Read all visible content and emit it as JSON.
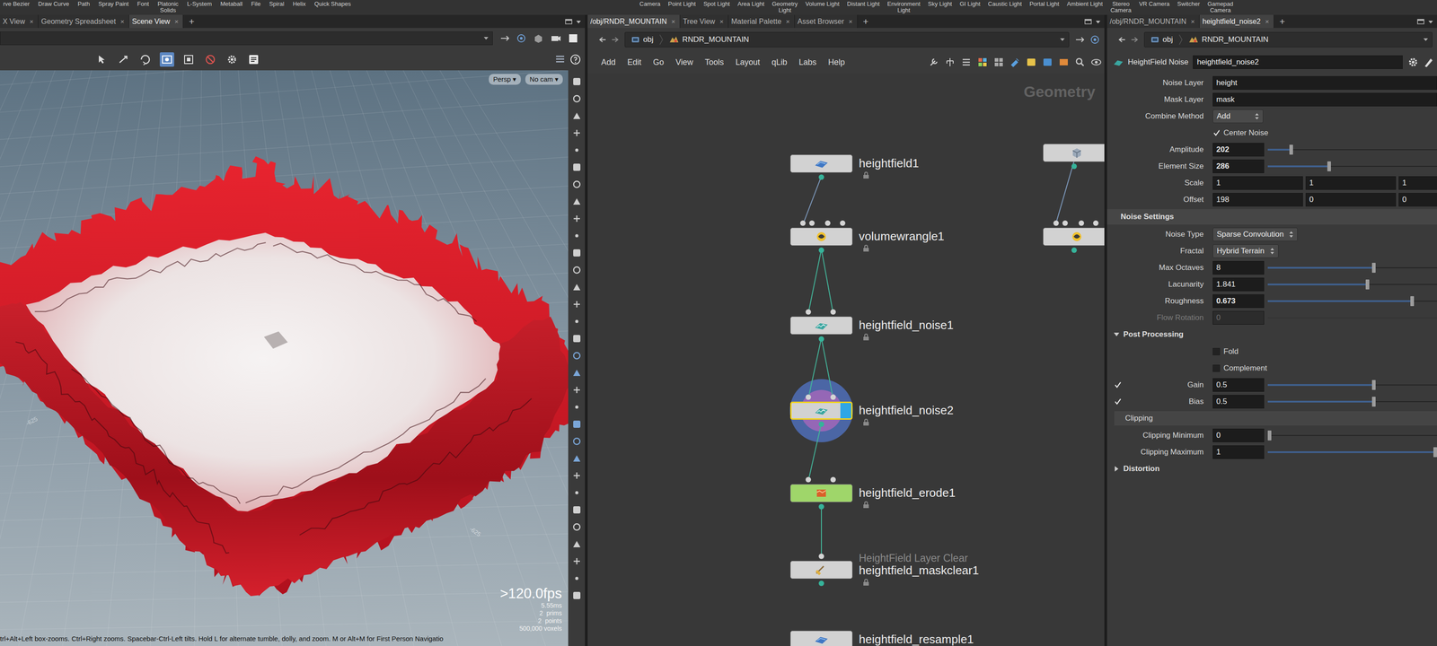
{
  "shelf": {
    "left": [
      "rve Bezier",
      "Draw Curve",
      "Path",
      "Spray Paint",
      "Font",
      "Platonic\nSolids",
      "L-System",
      "Metaball",
      "File",
      "Spiral",
      "Helix",
      "Quick Shapes"
    ],
    "right": [
      "Camera",
      "Point Light",
      "Spot Light",
      "Area Light",
      "Geometry\nLight",
      "Volume Light",
      "Distant Light",
      "Environment\nLight",
      "Sky Light",
      "GI Light",
      "Caustic Light",
      "Portal Light",
      "Ambient Light",
      "Stereo\nCamera",
      "VR Camera",
      "Switcher",
      "Gamepad\nCamera"
    ]
  },
  "tab_close": "×",
  "tab_add": "+",
  "viewer": {
    "tabs": [
      {
        "label": "X View",
        "selected": false
      },
      {
        "label": "Geometry Spreadsheet",
        "selected": false
      },
      {
        "label": "Scene View",
        "selected": true
      }
    ],
    "camera": "Persp",
    "camera_target": "No cam",
    "menu_arrow": "▾",
    "fps": ">120.0fps",
    "frame_time": "5.55ms",
    "stats": [
      "2  prims",
      "2  points",
      "500,000 voxels"
    ],
    "grid_labels": [
      "-625",
      "-625"
    ],
    "status": "trl+Alt+Left box-zooms. Ctrl+Right zooms. Spacebar-Ctrl-Left tilts. Hold L for alternate tumble, dolly, and zoom. M or Alt+M for First Person Navigatio"
  },
  "network": {
    "tabs": [
      {
        "label": "/obj/RNDR_MOUNTAIN",
        "selected": true
      },
      {
        "label": "Tree View",
        "selected": false
      },
      {
        "label": "Material Palette",
        "selected": false
      },
      {
        "label": "Asset Browser",
        "selected": false
      }
    ],
    "path": [
      "obj",
      "RNDR_MOUNTAIN"
    ],
    "menu": [
      "Add",
      "Edit",
      "Go",
      "View",
      "Tools",
      "Layout",
      "qLib",
      "Labs",
      "Help"
    ],
    "context": "Geometry",
    "nodes": [
      {
        "name": "heightfield1",
        "subtitle": "",
        "kind": "heightfield",
        "selected": false,
        "display_flag": false,
        "color": "#d2d2d2"
      },
      {
        "name": "volumewrangle1",
        "subtitle": "",
        "kind": "wrangle",
        "selected": false,
        "display_flag": false,
        "color": "#d2d2d2"
      },
      {
        "name": "heightfield_noise1",
        "subtitle": "",
        "kind": "noise",
        "selected": false,
        "display_flag": false,
        "color": "#d2d2d2"
      },
      {
        "name": "heightfield_noise2",
        "subtitle": "",
        "kind": "noise",
        "selected": true,
        "display_flag": true,
        "color": "#d2d2d2"
      },
      {
        "name": "heightfield_erode1",
        "subtitle": "",
        "kind": "erode",
        "selected": false,
        "display_flag": false,
        "color": "#9fd66a"
      },
      {
        "name": "heightfield_maskclear1",
        "subtitle": "HeightField Layer Clear",
        "kind": "maskclear",
        "selected": false,
        "display_flag": false,
        "color": "#d2d2d2"
      },
      {
        "name": "heightfield_resample1",
        "subtitle": "",
        "kind": "heightfield",
        "selected": false,
        "display_flag": false,
        "color": "#d2d2d2"
      }
    ],
    "partial_nodes": [
      {
        "kind": "box"
      },
      {
        "kind": "wrangle"
      }
    ]
  },
  "parameters": {
    "tabs": [
      {
        "label": "/obj/RNDR_MOUNTAIN",
        "selected": false
      },
      {
        "label": "heightfield_noise2",
        "selected": true
      }
    ],
    "path": [
      "obj",
      "RNDR_MOUNTAIN"
    ],
    "node_type": "HeightField Noise",
    "node_name": "heightfield_noise2",
    "rows": [
      {
        "kind": "text",
        "label": "Noise Layer",
        "value": "height"
      },
      {
        "kind": "text",
        "label": "Mask Layer",
        "value": "mask"
      },
      {
        "kind": "menu",
        "label": "Combine Method",
        "value": "Add"
      },
      {
        "kind": "toggle",
        "label": "Center Noise",
        "checked": true
      },
      {
        "kind": "float",
        "label": "Amplitude",
        "value": "202",
        "level": 0.13,
        "modified": true,
        "disabled": false
      },
      {
        "kind": "float",
        "label": "Element Size",
        "value": "286",
        "level": 0.36,
        "modified": true,
        "disabled": false
      },
      {
        "kind": "vector",
        "label": "Scale",
        "values": [
          "1",
          "1",
          "1"
        ]
      },
      {
        "kind": "vector",
        "label": "Offset",
        "values": [
          "198",
          "0",
          "0"
        ]
      },
      {
        "kind": "heading",
        "label": "Noise Settings"
      },
      {
        "kind": "menu",
        "label": "Noise Type",
        "value": "Sparse Convolution"
      },
      {
        "kind": "menu",
        "label": "Fractal",
        "value": "Hybrid Terrain"
      },
      {
        "kind": "float",
        "label": "Max Octaves",
        "value": "8",
        "level": 0.63,
        "modified": false,
        "disabled": false
      },
      {
        "kind": "float",
        "label": "Lacunarity",
        "value": "1.841",
        "level": 0.59,
        "modified": false,
        "disabled": false
      },
      {
        "kind": "float",
        "label": "Roughness",
        "value": "0.673",
        "level": 0.86,
        "modified": true,
        "disabled": false
      },
      {
        "kind": "float",
        "label": "Flow Rotation",
        "value": "0",
        "level": 0,
        "modified": false,
        "disabled": true
      },
      {
        "kind": "folder",
        "label": "Post Processing",
        "expanded": true
      },
      {
        "kind": "toggle",
        "label": "Fold",
        "checked": false
      },
      {
        "kind": "toggle",
        "label": "Complement",
        "checked": false
      },
      {
        "kind": "float",
        "label": "Gain",
        "value": "0.5",
        "level": 0.63,
        "modified": false,
        "disabled": false,
        "enabled": true
      },
      {
        "kind": "float",
        "label": "Bias",
        "value": "0.5",
        "level": 0.63,
        "modified": false,
        "disabled": false,
        "enabled": true
      },
      {
        "kind": "subheading",
        "label": "Clipping"
      },
      {
        "kind": "float",
        "label": "Clipping Minimum",
        "value": "0",
        "level": 0,
        "modified": false,
        "disabled": false
      },
      {
        "kind": "float",
        "label": "Clipping Maximum",
        "value": "1",
        "level": 1,
        "modified": false,
        "disabled": false
      },
      {
        "kind": "folder",
        "label": "Distortion",
        "expanded": false
      }
    ]
  }
}
